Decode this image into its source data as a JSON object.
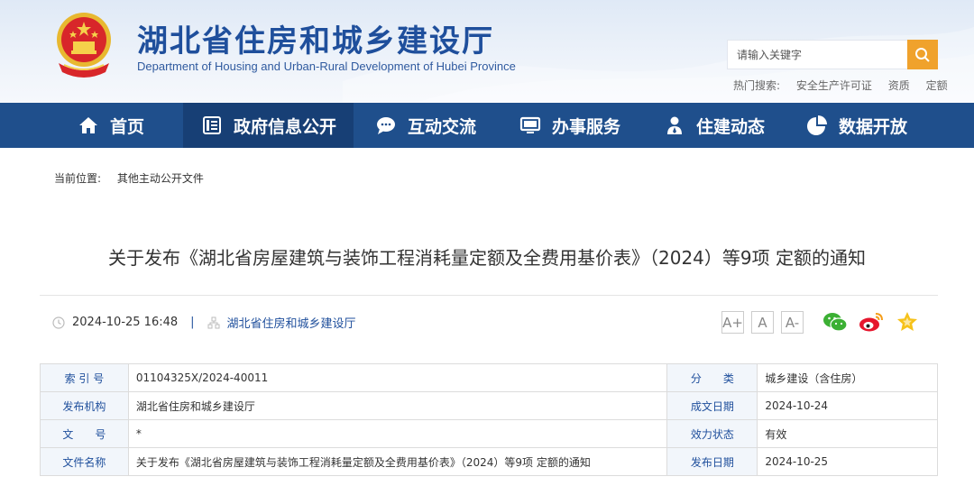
{
  "header": {
    "title": "湖北省住房和城乡建设厅",
    "subtitle": "Department of Housing and Urban-Rural Development of Hubei Province",
    "search_placeholder": "请输入关键字",
    "hot_search_label": "热门搜索:",
    "hot_keywords": [
      "安全生产许可证",
      "资质",
      "定额"
    ]
  },
  "nav": {
    "items": [
      {
        "label": "首页",
        "icon": "home-icon"
      },
      {
        "label": "政府信息公开",
        "icon": "document-icon"
      },
      {
        "label": "互动交流",
        "icon": "chat-icon"
      },
      {
        "label": "办事服务",
        "icon": "monitor-icon"
      },
      {
        "label": "住建动态",
        "icon": "person-icon"
      },
      {
        "label": "数据开放",
        "icon": "pie-chart-icon"
      }
    ],
    "active_index": 1
  },
  "breadcrumb": {
    "label": "当前位置:",
    "current": "其他主动公开文件"
  },
  "article": {
    "title": "关于发布《湖北省房屋建筑与装饰工程消耗量定额及全费用基价表》（2024）等9项 定额的通知",
    "datetime": "2024-10-25 16:48",
    "separator": "|",
    "publisher": "湖北省住房和城乡建设厅",
    "font_buttons": [
      "A+",
      "A",
      "A-"
    ]
  },
  "info": {
    "rows": [
      {
        "k1": "索 引 号",
        "v1": "01104325X/2024-40011",
        "k2": "分　　类",
        "v2": "城乡建设（含住房）"
      },
      {
        "k1": "发布机构",
        "v1": "湖北省住房和城乡建设厅",
        "k2": "成文日期",
        "v2": "2024-10-24"
      },
      {
        "k1": "文　　号",
        "v1": "*",
        "k2": "效力状态",
        "v2": "有效"
      },
      {
        "k1": "文件名称",
        "v1": "关于发布《湖北省房屋建筑与装饰工程消耗量定额及全费用基价表》（2024）等9项 定额的通知",
        "k2": "发布日期",
        "v2": "2024-10-25"
      }
    ]
  },
  "colors": {
    "brand_blue": "#1f4f8c",
    "nav_active": "#173f75",
    "search_orange": "#f0a22c"
  }
}
